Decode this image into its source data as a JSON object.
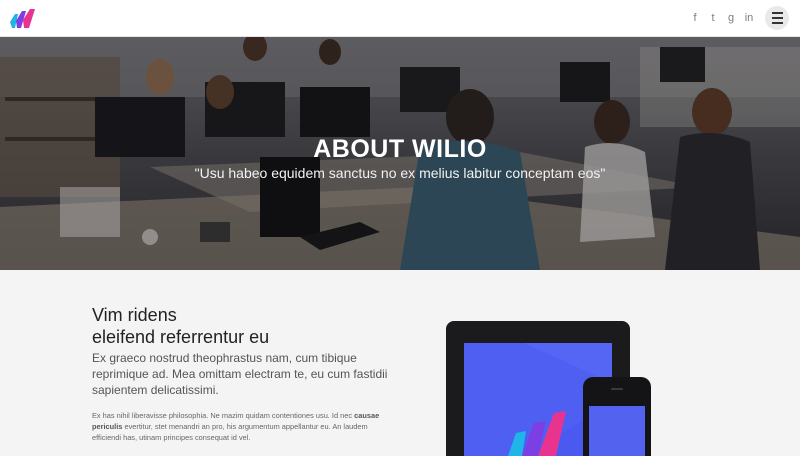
{
  "header": {
    "logo_name": "wilio-logo",
    "social": [
      {
        "icon": "facebook-icon",
        "glyph": "f"
      },
      {
        "icon": "twitter-icon",
        "glyph": "t"
      },
      {
        "icon": "google-plus-icon",
        "glyph": "g"
      },
      {
        "icon": "linkedin-icon",
        "glyph": "in"
      }
    ],
    "menu_icon": "hamburger-icon"
  },
  "hero": {
    "title": "ABOUT WILIO",
    "subtitle": "\"Usu habeo equidem sanctus no ex melius labitur conceptam eos\""
  },
  "about": {
    "heading_line1": "Vim ridens",
    "heading_line2": "eleifend referrentur eu",
    "lead": "Ex graeco nostrud theophrastus nam, cum tibique reprimique ad. Mea omittam electram te, eu cum fastidii sapientem delicatissimi.",
    "small_pre": "Ex has nihil liberavisse philosophia. Ne mazim quidam contentiones usu. Id nec ",
    "small_bold": "causae periculis",
    "small_post": " evertitur, stet menandri an pro, his argumentum appellantur eu. An laudem efficiendi has, utinam principes consequat id vel."
  },
  "colors": {
    "accent_blue": "#4a5af0",
    "logo_pink": "#e8348f",
    "logo_purple": "#7b3fe4",
    "logo_cyan": "#1fb5e8"
  }
}
